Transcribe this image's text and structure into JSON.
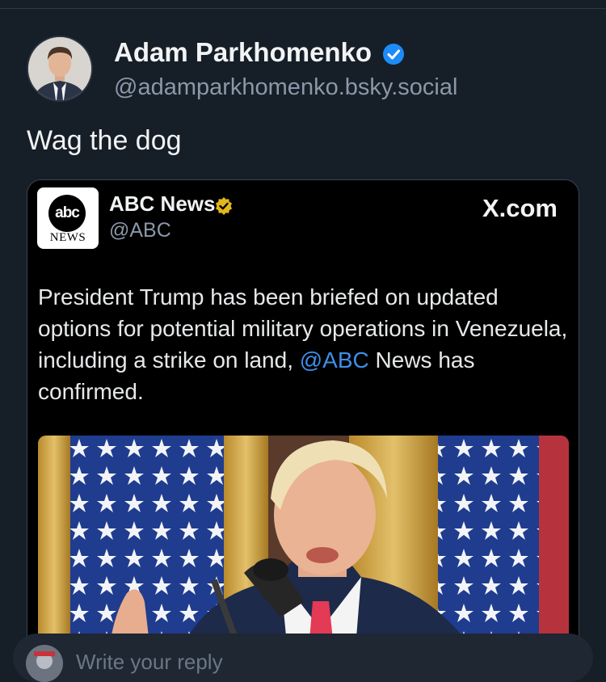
{
  "post": {
    "author": {
      "display_name": "Adam Parkhomenko",
      "handle": "@adamparkhomenko.bsky.social",
      "verified": true,
      "verified_color": "#1d8cf8"
    },
    "text": "Wag the dog"
  },
  "embed": {
    "source_logo": {
      "top": "abc",
      "bottom": "NEWS"
    },
    "source_name": "ABC News",
    "source_handle": "@ABC",
    "source_verified_color": "#e2b719",
    "site": "X.com",
    "text_before": "President Trump has been briefed on updated options for potential military operations in Venezuela, including a strike on land, ",
    "mention": "@ABC",
    "text_after": " News has confirmed.",
    "mention_color": "#3e8ee8"
  },
  "reply": {
    "placeholder": "Write your reply"
  },
  "colors": {
    "background": "#161e27",
    "embed_background": "#000000"
  }
}
